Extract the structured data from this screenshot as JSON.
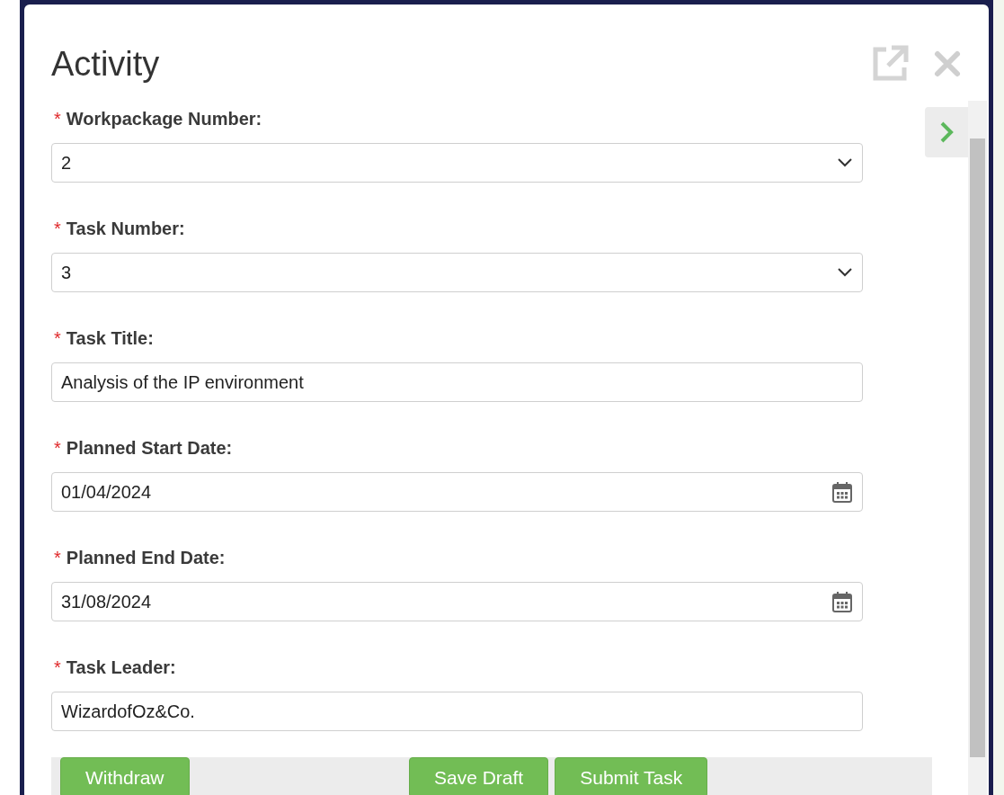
{
  "dialog": {
    "title": "Activity"
  },
  "fields": [
    {
      "kind": "select",
      "label": "Workpackage Number:",
      "required": true,
      "value": "2"
    },
    {
      "kind": "select",
      "label": "Task Number:",
      "required": true,
      "value": "3"
    },
    {
      "kind": "text",
      "label": "Task Title:",
      "required": true,
      "value": "Analysis of the IP environment"
    },
    {
      "kind": "date",
      "label": "Planned Start Date:",
      "required": true,
      "value": "01/04/2024"
    },
    {
      "kind": "date",
      "label": "Planned End Date:",
      "required": true,
      "value": "31/08/2024"
    },
    {
      "kind": "text",
      "label": "Task Leader:",
      "required": true,
      "value": "WizardofOz&Co."
    }
  ],
  "required_mark": "*",
  "buttons_left": [
    "Withdraw"
  ],
  "buttons_center": [
    "Save Draft",
    "Submit Task"
  ]
}
